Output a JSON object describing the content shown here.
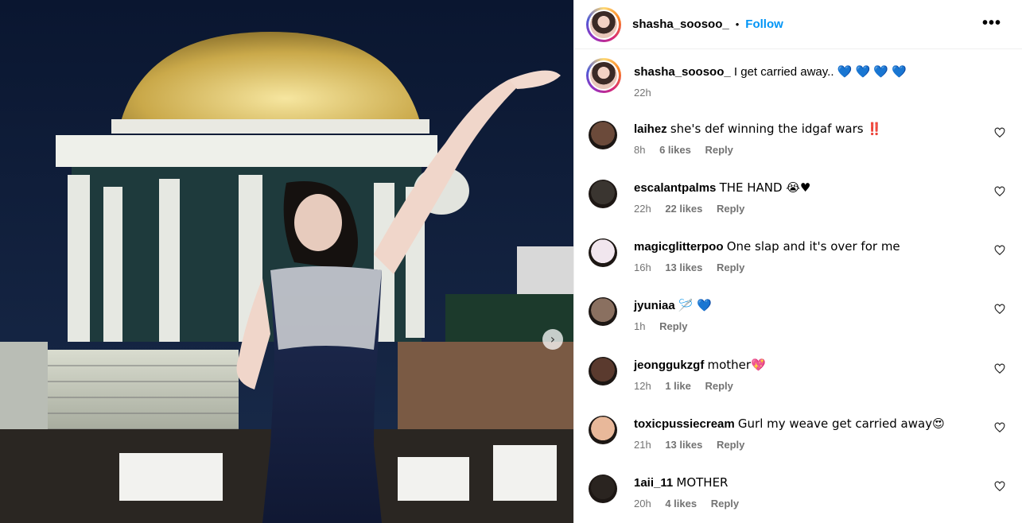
{
  "post": {
    "author": "shasha_soosoo_",
    "separator": "•",
    "follow_label": "Follow",
    "more_label": "•••",
    "next_label": "›",
    "caption_text": "I get carried away.. 💙 💙 💙 💙",
    "caption_time": "22h"
  },
  "comments": [
    {
      "user": "laihez",
      "text": "she's def winning the idgaf wars ‼️",
      "time": "8h",
      "likes": "6 likes",
      "reply": "Reply",
      "avatar_color": "#6b4a3a"
    },
    {
      "user": "escalantpalms",
      "text": "THE HAND 😭♥",
      "time": "22h",
      "likes": "22 likes",
      "reply": "Reply",
      "avatar_color": "#3a3530"
    },
    {
      "user": "magicglitterpoo",
      "text": "One slap and it's over for me",
      "time": "16h",
      "likes": "13 likes",
      "reply": "Reply",
      "avatar_color": "#f1e6ee"
    },
    {
      "user": "jyuniaa",
      "text": "🪡 💙",
      "time": "1h",
      "likes": "",
      "reply": "Reply",
      "avatar_color": "#8a7060"
    },
    {
      "user": "jeonggukzgf",
      "text": "mother💖",
      "time": "12h",
      "likes": "1 like",
      "reply": "Reply",
      "avatar_color": "#5a3a2e"
    },
    {
      "user": "toxicpussiecream",
      "text": "Gurl my weave get carried away😍",
      "time": "21h",
      "likes": "13 likes",
      "reply": "Reply",
      "avatar_color": "#e8b89a"
    },
    {
      "user": "1aii_11",
      "text": "MOTHER",
      "time": "20h",
      "likes": "4 likes",
      "reply": "Reply",
      "avatar_color": "#2a2420"
    }
  ],
  "colors": {
    "accent": "#0095f6",
    "muted": "#737373",
    "border": "#efefef"
  }
}
